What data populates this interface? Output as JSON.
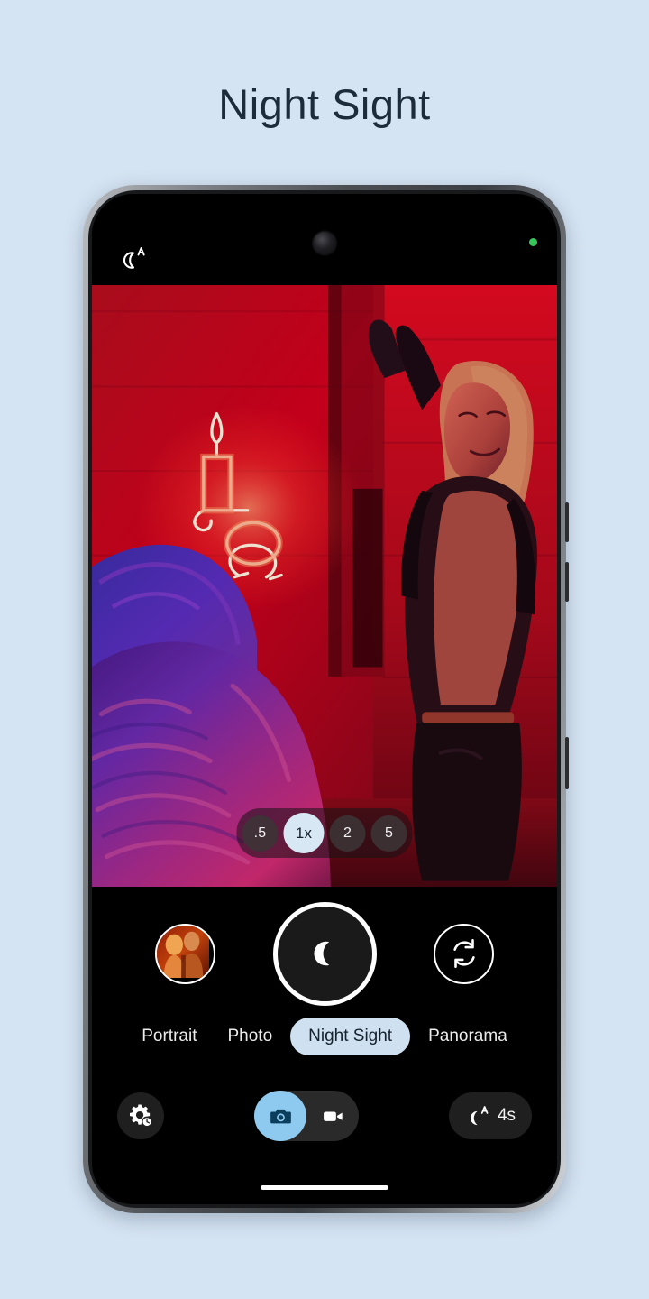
{
  "page": {
    "title": "Night Sight",
    "background_color": "#d5e4f3",
    "title_color": "#1d2c3a"
  },
  "status_bar": {
    "night_sight_auto_icon": "moon-auto-icon",
    "front_camera_icon": "front-camera-punch-hole",
    "privacy_indicator_icon": "green-privacy-dot",
    "privacy_indicator_color": "#34c759"
  },
  "viewfinder": {
    "scene_description": "Low-light photo of two people against a red neon-lit brick wall with a neon candle sign",
    "zoom_levels": [
      {
        "label": ".5",
        "selected": false
      },
      {
        "label": "1x",
        "selected": true
      },
      {
        "label": "2",
        "selected": false
      },
      {
        "label": "5",
        "selected": false
      }
    ],
    "zoom_active_bg": "#d7e7f4"
  },
  "controls": {
    "thumbnail": {
      "icon": "gallery-thumbnail",
      "alt": "Last captured photo"
    },
    "shutter": {
      "icon": "moon-icon",
      "label": "Capture"
    },
    "flip_camera": {
      "icon": "camera-flip-icon",
      "label": "Switch camera"
    }
  },
  "modes": [
    {
      "label": "Portrait",
      "selected": false
    },
    {
      "label": "Photo",
      "selected": false
    },
    {
      "label": "Night Sight",
      "selected": true
    },
    {
      "label": "Panorama",
      "selected": false
    }
  ],
  "mode_active_bg": "#cfe1f1",
  "bottom_bar": {
    "settings": {
      "icon": "gear-timer-icon",
      "label": "Settings"
    },
    "capture_toggle": {
      "photo": {
        "icon": "camera-icon",
        "selected": true
      },
      "video": {
        "icon": "video-icon",
        "selected": false
      },
      "active_color": "#8ecaf0"
    },
    "night_timer": {
      "icon": "moon-auto-icon",
      "value": "4s"
    }
  },
  "navigation": {
    "gesture_bar": "home-gesture-bar"
  }
}
